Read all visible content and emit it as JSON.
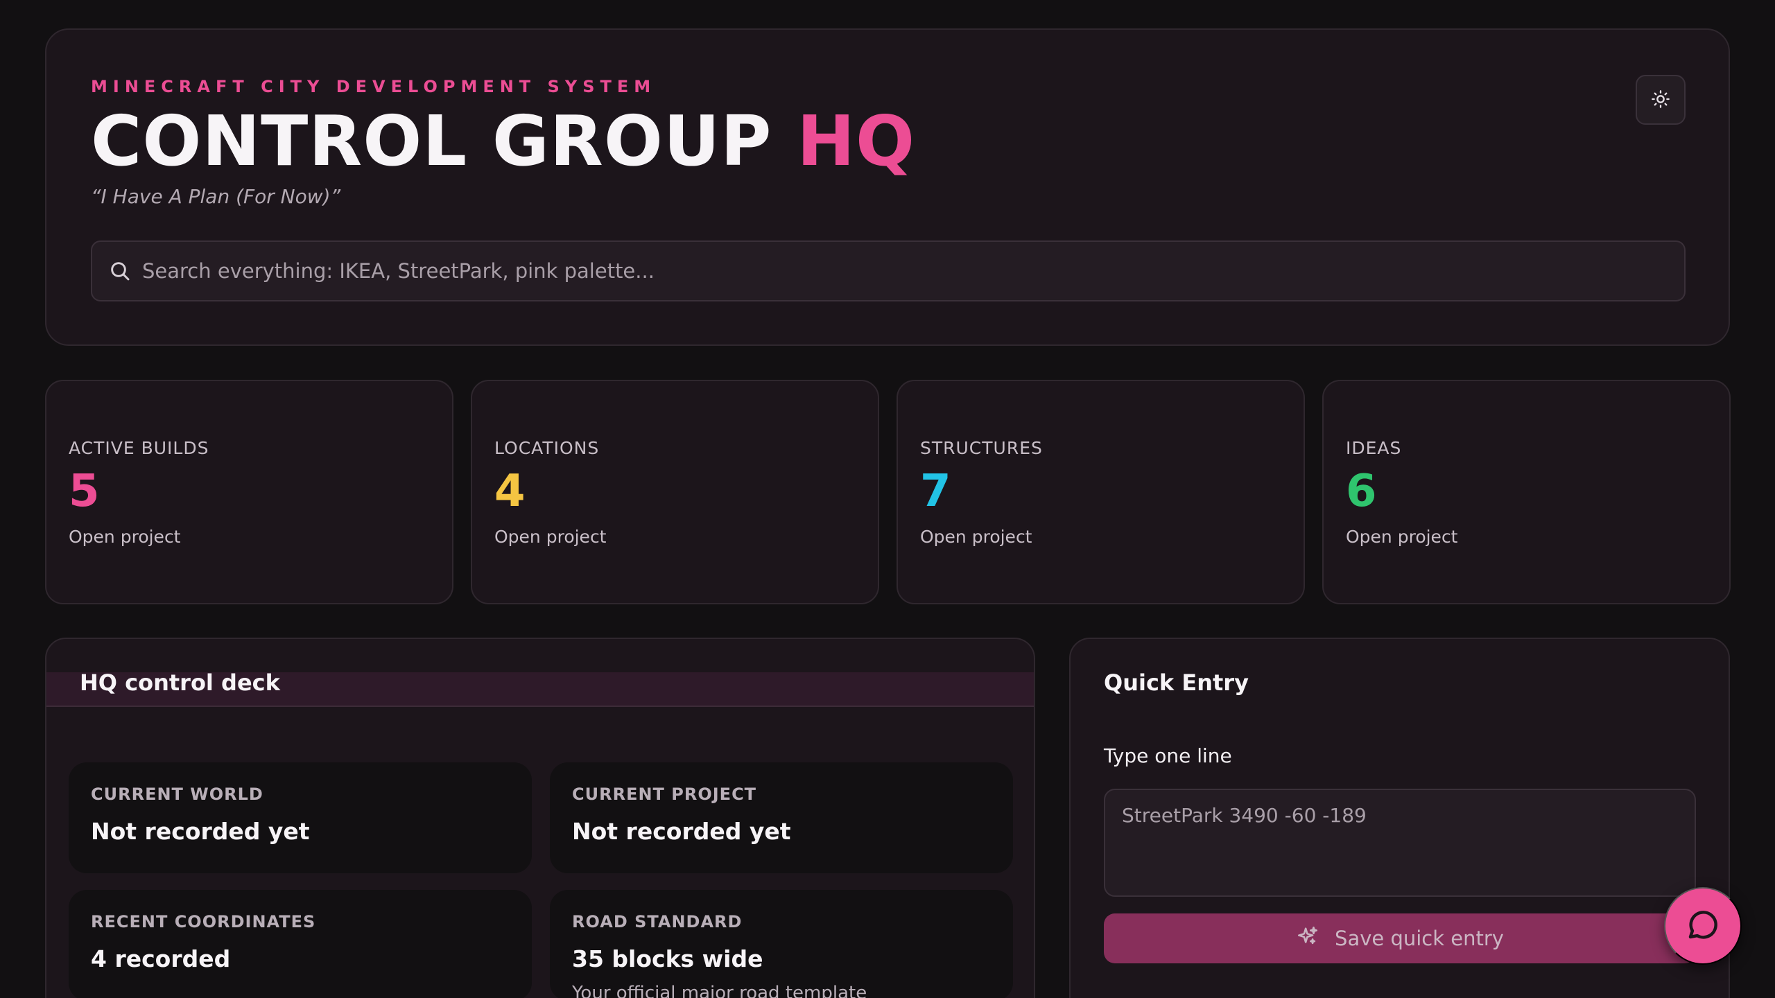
{
  "header": {
    "eyebrow": "MINECRAFT CITY DEVELOPMENT SYSTEM",
    "title_main": "CONTROL GROUP ",
    "title_accent": "HQ",
    "tagline": "“I Have A Plan (For Now)”",
    "theme_toggle_icon": "sun-icon",
    "search": {
      "placeholder": "Search everything: IKEA, StreetPark, pink palette...",
      "value": ""
    }
  },
  "stats": [
    {
      "label": "ACTIVE BUILDS",
      "value": "5",
      "sub": "Open project",
      "color": "#ec4d94"
    },
    {
      "label": "LOCATIONS",
      "value": "4",
      "sub": "Open project",
      "color": "#f5c542"
    },
    {
      "label": "STRUCTURES",
      "value": "7",
      "sub": "Open project",
      "color": "#22c3e6"
    },
    {
      "label": "IDEAS",
      "value": "6",
      "sub": "Open project",
      "color": "#2fc46e"
    }
  ],
  "deck": {
    "title": "HQ control deck",
    "tiles": [
      {
        "label": "CURRENT WORLD",
        "value": "Not recorded yet",
        "sub": ""
      },
      {
        "label": "CURRENT PROJECT",
        "value": "Not recorded yet",
        "sub": ""
      },
      {
        "label": "RECENT COORDINATES",
        "value": "4 recorded",
        "sub": ""
      },
      {
        "label": "ROAD STANDARD",
        "value": "35 blocks wide",
        "sub": "Your official major road template"
      }
    ]
  },
  "quick_entry": {
    "title": "Quick Entry",
    "label": "Type one line",
    "placeholder": "StreetPark 3490 -60 -189",
    "save_label": "Save quick entry",
    "save_icon": "sparkles-icon"
  },
  "chat_fab_icon": "chat-bubble-icon",
  "colors": {
    "accent": "#ec4d94",
    "background": "#121012",
    "card": "#1c151b"
  }
}
